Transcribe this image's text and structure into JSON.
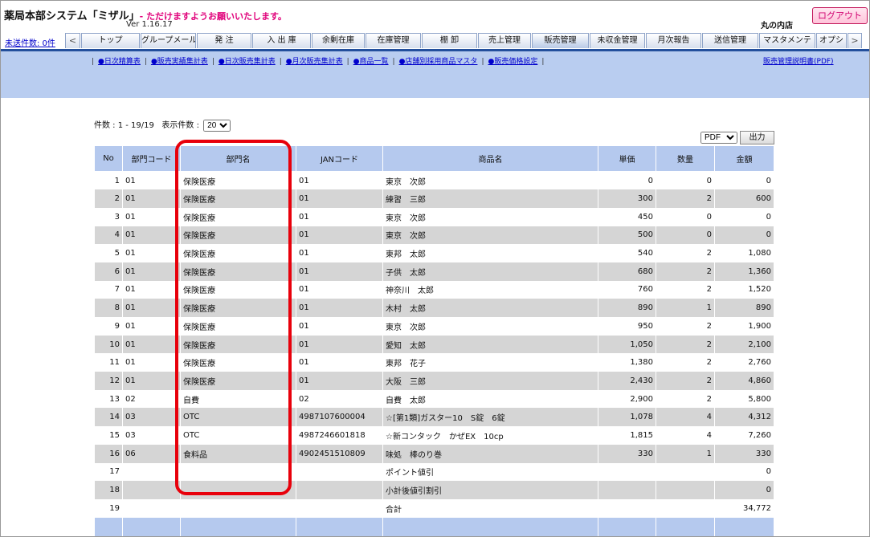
{
  "header": {
    "app_title": "薬局本部システム「ミザル」",
    "app_tag": "- ただけますようお願いいたします。",
    "version": "Ver 1.16.17",
    "store_name": "丸の内店",
    "logout_label": "ログアウト",
    "unsent_label": "未送件数: 0件"
  },
  "tabs": {
    "left_arrow": "<",
    "right_arrow": ">",
    "items": [
      "トップ",
      "グループメール",
      "発 注",
      "入 出 庫",
      "余剰在庫",
      "在庫管理",
      "棚 卸",
      "売上管理",
      "販売管理",
      "未収金管理",
      "月次報告",
      "送信管理",
      "マスタメンテ",
      "オプシ"
    ],
    "active": "販売管理"
  },
  "subnav": {
    "items": [
      "●日次精算表",
      "●販売実績集計表",
      "●日次販売集計表",
      "●月次販売集計表",
      "●商品一覧",
      "●店舗別採用商品マスタ",
      "●販売価格設定"
    ],
    "manual_link": "販売管理説明書(PDF)"
  },
  "listing": {
    "count_label": "件数 : 1 - 19/19",
    "display_label": "表示件数 :",
    "display_value": "20",
    "export_format": "PDF",
    "output_button": "出力"
  },
  "table": {
    "headers": [
      "No",
      "部門コード",
      "部門名",
      "JANコード",
      "商品名",
      "単価",
      "数量",
      "金額"
    ],
    "rows": [
      {
        "no": "1",
        "dept_code": "01",
        "dept_name": "保険医療",
        "jan": "01",
        "product": "東京　次郎",
        "price": "0",
        "qty": "0",
        "amount": "0"
      },
      {
        "no": "2",
        "dept_code": "01",
        "dept_name": "保険医療",
        "jan": "01",
        "product": "練習　三郎",
        "price": "300",
        "qty": "2",
        "amount": "600"
      },
      {
        "no": "3",
        "dept_code": "01",
        "dept_name": "保険医療",
        "jan": "01",
        "product": "東京　次郎",
        "price": "450",
        "qty": "0",
        "amount": "0"
      },
      {
        "no": "4",
        "dept_code": "01",
        "dept_name": "保険医療",
        "jan": "01",
        "product": "東京　次郎",
        "price": "500",
        "qty": "0",
        "amount": "0"
      },
      {
        "no": "5",
        "dept_code": "01",
        "dept_name": "保険医療",
        "jan": "01",
        "product": "東邦　太郎",
        "price": "540",
        "qty": "2",
        "amount": "1,080"
      },
      {
        "no": "6",
        "dept_code": "01",
        "dept_name": "保険医療",
        "jan": "01",
        "product": "子供　太郎",
        "price": "680",
        "qty": "2",
        "amount": "1,360"
      },
      {
        "no": "7",
        "dept_code": "01",
        "dept_name": "保険医療",
        "jan": "01",
        "product": "神奈川　太郎",
        "price": "760",
        "qty": "2",
        "amount": "1,520"
      },
      {
        "no": "8",
        "dept_code": "01",
        "dept_name": "保険医療",
        "jan": "01",
        "product": "木村　太郎",
        "price": "890",
        "qty": "1",
        "amount": "890"
      },
      {
        "no": "9",
        "dept_code": "01",
        "dept_name": "保険医療",
        "jan": "01",
        "product": "東京　次郎",
        "price": "950",
        "qty": "2",
        "amount": "1,900"
      },
      {
        "no": "10",
        "dept_code": "01",
        "dept_name": "保険医療",
        "jan": "01",
        "product": "愛知　太郎",
        "price": "1,050",
        "qty": "2",
        "amount": "2,100"
      },
      {
        "no": "11",
        "dept_code": "01",
        "dept_name": "保険医療",
        "jan": "01",
        "product": "東邦　花子",
        "price": "1,380",
        "qty": "2",
        "amount": "2,760"
      },
      {
        "no": "12",
        "dept_code": "01",
        "dept_name": "保険医療",
        "jan": "01",
        "product": "大阪　三郎",
        "price": "2,430",
        "qty": "2",
        "amount": "4,860"
      },
      {
        "no": "13",
        "dept_code": "02",
        "dept_name": "自費",
        "jan": "02",
        "product": "自費　太郎",
        "price": "2,900",
        "qty": "2",
        "amount": "5,800"
      },
      {
        "no": "14",
        "dept_code": "03",
        "dept_name": "OTC",
        "jan": "4987107600004",
        "product": "☆[第1類]ガスター10　S錠　6錠",
        "price": "1,078",
        "qty": "4",
        "amount": "4,312"
      },
      {
        "no": "15",
        "dept_code": "03",
        "dept_name": "OTC",
        "jan": "4987246601818",
        "product": "☆新コンタック　かぜEX　10cp",
        "price": "1,815",
        "qty": "4",
        "amount": "7,260"
      },
      {
        "no": "16",
        "dept_code": "06",
        "dept_name": "食料品",
        "jan": "4902451510809",
        "product": "味処　棒のり巻",
        "price": "330",
        "qty": "1",
        "amount": "330"
      },
      {
        "no": "17",
        "dept_code": "",
        "dept_name": "",
        "jan": "",
        "product": "ポイント値引",
        "price": "",
        "qty": "",
        "amount": "0"
      },
      {
        "no": "18",
        "dept_code": "",
        "dept_name": "",
        "jan": "",
        "product": "小計後値引割引",
        "price": "",
        "qty": "",
        "amount": "0"
      },
      {
        "no": "19",
        "dept_code": "",
        "dept_name": "",
        "jan": "",
        "product": "合計",
        "price": "",
        "qty": "",
        "amount": "34,772"
      }
    ]
  },
  "colors": {
    "nav_blue": "#234f9c",
    "band_blue": "#b9cdf0",
    "header_blue": "#b5c9ee",
    "stripe_gray": "#d5d5d5",
    "highlight_red": "#e8000b",
    "logout_pink": "#d0006f"
  }
}
